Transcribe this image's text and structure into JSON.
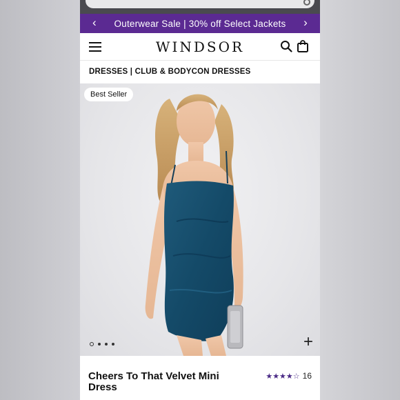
{
  "promo_banner": {
    "text": "Outerwear Sale | 30% off Select Jackets",
    "prev_icon": "chevron-left-icon",
    "next_icon": "chevron-right-icon",
    "color": "#5b2a92"
  },
  "header": {
    "logo": "WINDSOR",
    "menu_icon": "hamburger-menu-icon",
    "search_icon": "search-icon",
    "bag_icon": "shopping-bag-icon"
  },
  "breadcrumb": "DRESSES | CLUB & BODYCON DRESSES",
  "hero": {
    "badge": "Best Seller",
    "add_icon": "plus-icon",
    "image_count": 4,
    "active_image": 1
  },
  "product": {
    "title": "Cheers To That Velvet Mini Dress",
    "rating": 4.5,
    "review_count": "16",
    "star_color": "#4a2a86"
  }
}
